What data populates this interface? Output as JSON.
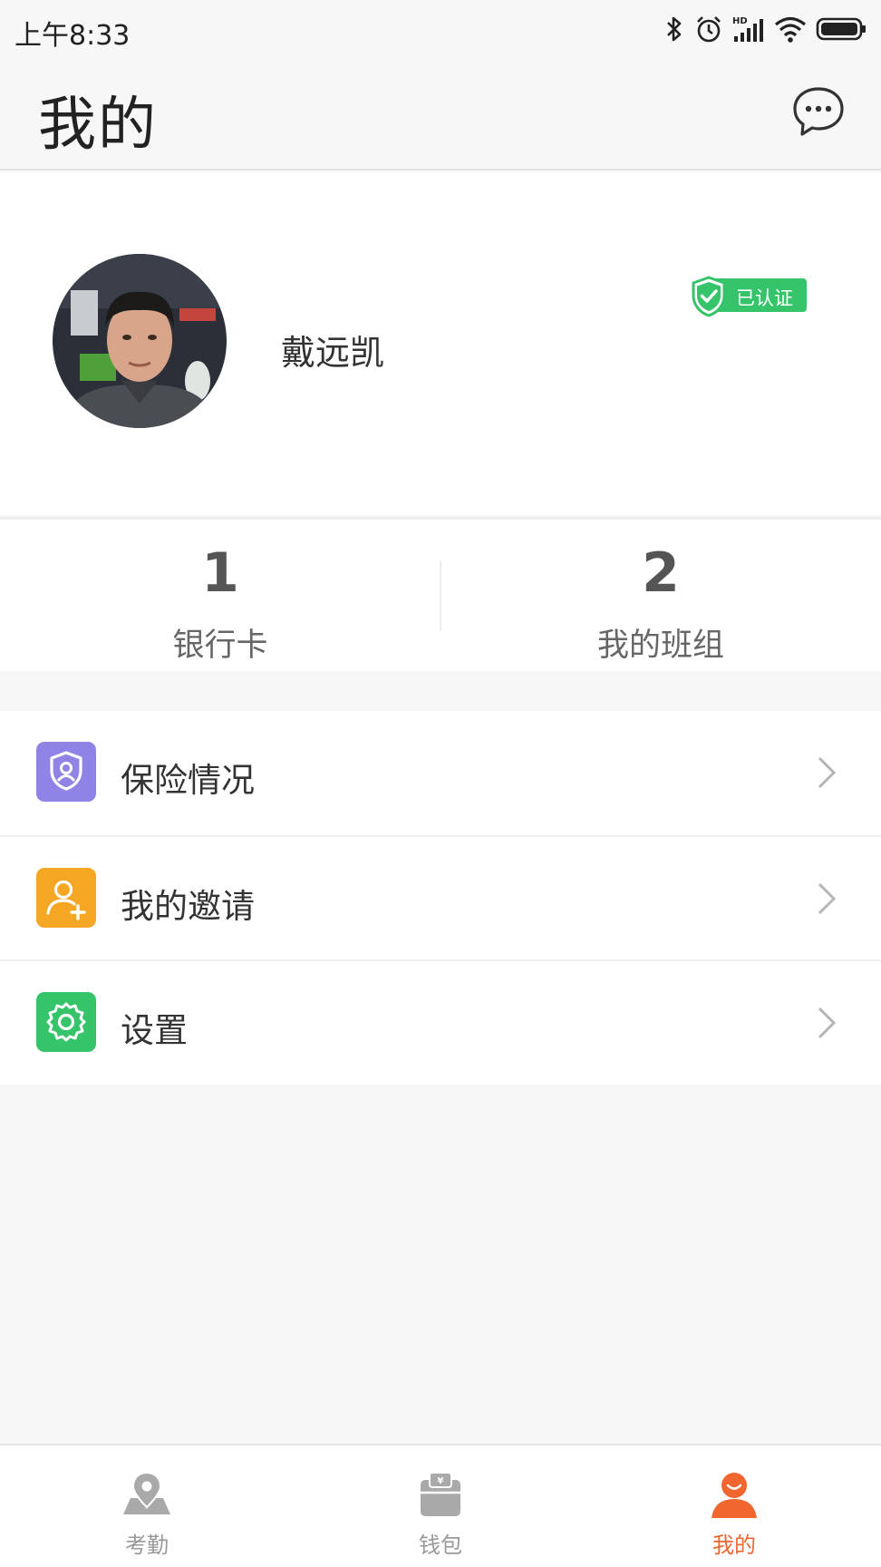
{
  "status_bar": {
    "time": "上午8:33",
    "icons": [
      "bluetooth-icon",
      "alarm-icon",
      "hd-signal-icon",
      "wifi-icon",
      "battery-icon"
    ]
  },
  "header": {
    "title": "我的",
    "message_icon": "chat-bubble-icon"
  },
  "profile": {
    "name": "戴远凯",
    "verified_label": "已认证",
    "verified_color": "#35c46a"
  },
  "stats": [
    {
      "value": "1",
      "label": "银行卡"
    },
    {
      "value": "2",
      "label": "我的班组"
    }
  ],
  "menu": [
    {
      "label": "保险情况",
      "icon": "insurance-shield-icon",
      "color": "#8f84e6"
    },
    {
      "label": "我的邀请",
      "icon": "add-user-icon",
      "color": "#f5a623"
    },
    {
      "label": "设置",
      "icon": "gear-icon",
      "color": "#35c46a"
    }
  ],
  "tabbar": {
    "active_color": "#f0662e",
    "inactive_color": "#999999",
    "tabs": [
      {
        "label": "考勤",
        "icon": "location-pin-icon",
        "active": false
      },
      {
        "label": "钱包",
        "icon": "wallet-icon",
        "active": false
      },
      {
        "label": "我的",
        "icon": "user-icon",
        "active": true
      }
    ]
  }
}
